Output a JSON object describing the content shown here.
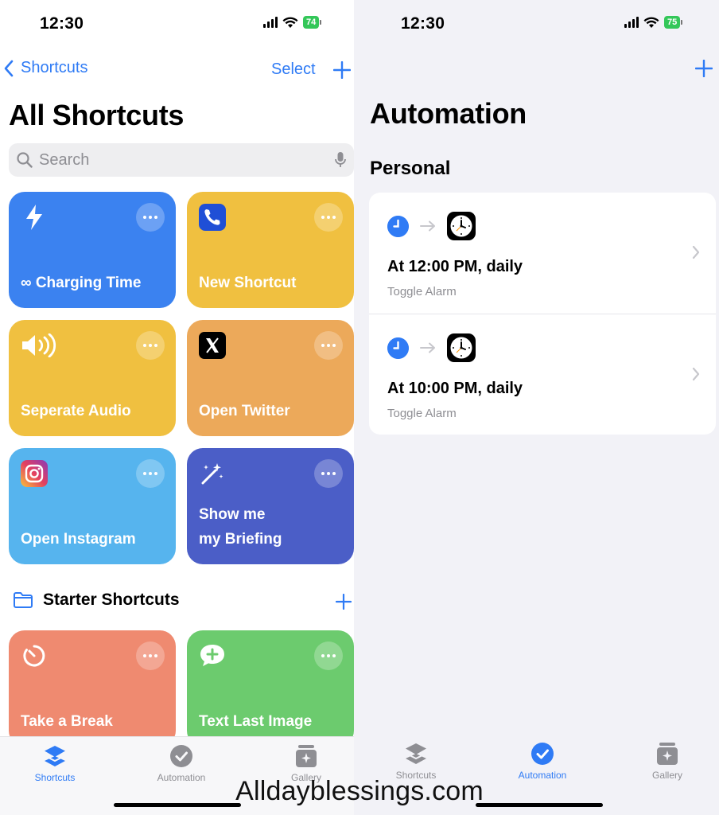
{
  "left": {
    "status": {
      "time": "12:30",
      "battery": "74"
    },
    "nav": {
      "back_label": "Shortcuts",
      "select_label": "Select"
    },
    "title": "All Shortcuts",
    "search": {
      "placeholder": "Search"
    },
    "tiles": [
      {
        "label": "∞ Charging Time",
        "color": "#3b82f0",
        "icon": "bolt-icon"
      },
      {
        "label": "New Shortcut",
        "color": "#f0c040",
        "icon": "phone-app-icon"
      },
      {
        "label": "Seperate Audio",
        "color": "#f0c040",
        "icon": "speaker-icon"
      },
      {
        "label": "Open Twitter",
        "color": "#eca95a",
        "icon": "x-app-icon"
      },
      {
        "label": "Open Instagram",
        "color": "#56b4ee",
        "icon": "instagram-app-icon"
      },
      {
        "label": "Show me my Briefing",
        "label_line1": "Show me",
        "label_line2": "my Briefing",
        "color": "#4b5ec7",
        "icon": "magic-wand-icon"
      }
    ],
    "starter": {
      "title": "Starter Shortcuts",
      "tiles": [
        {
          "label": "Take a Break",
          "color": "#ef8a70",
          "icon": "timer-icon"
        },
        {
          "label": "Text Last Image",
          "color": "#6ccb6e",
          "icon": "message-plus-icon"
        }
      ]
    },
    "tabbar": [
      {
        "label": "Shortcuts",
        "active": true
      },
      {
        "label": "Automation",
        "active": false
      },
      {
        "label": "Gallery",
        "active": false
      }
    ]
  },
  "right": {
    "status": {
      "time": "12:30",
      "battery": "75"
    },
    "title": "Automation",
    "section": "Personal",
    "automations": [
      {
        "title": "At 12:00 PM, daily",
        "subtitle": "Toggle Alarm"
      },
      {
        "title": "At 10:00 PM, daily",
        "subtitle": "Toggle Alarm"
      }
    ],
    "tabbar": [
      {
        "label": "Shortcuts",
        "active": false
      },
      {
        "label": "Automation",
        "active": true
      },
      {
        "label": "Gallery",
        "active": false
      }
    ]
  },
  "watermark": "Alldayblessings.com",
  "colors": {
    "accent": "#2f7bf5",
    "battery": "#34c759"
  }
}
